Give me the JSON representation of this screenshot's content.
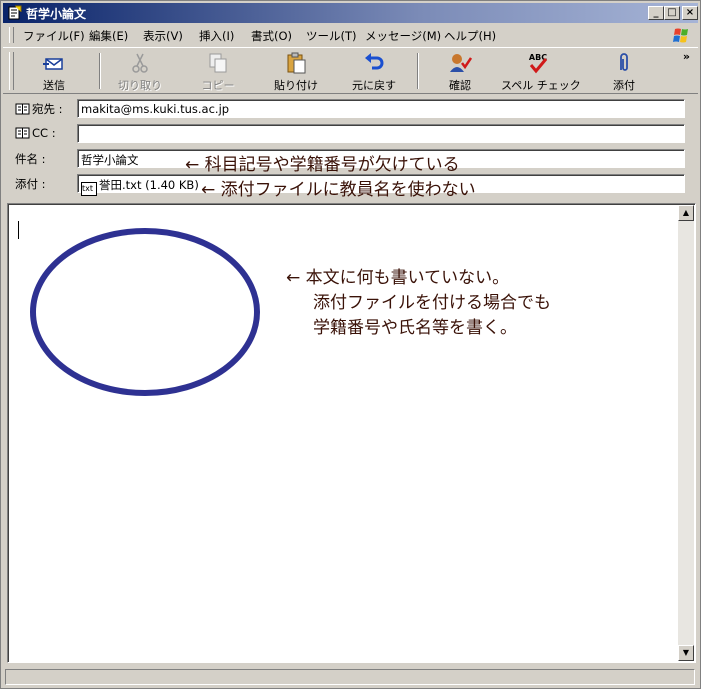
{
  "window": {
    "title": "哲学小論文",
    "min_label": "_",
    "max_label": "□",
    "close_label": "×"
  },
  "menu": {
    "items": [
      "ファイル(F)",
      "編集(E)",
      "表示(V)",
      "挿入(I)",
      "書式(O)",
      "ツール(T)",
      "メッセージ(M)",
      "ヘルプ(H)"
    ]
  },
  "toolbar": {
    "send": "送信",
    "cut": "切り取り",
    "copy": "コピー",
    "paste": "貼り付け",
    "undo": "元に戻す",
    "check": "確認",
    "spell": "スペル チェック",
    "attach": "添付",
    "overflow": "»",
    "spell_badge": "ABC"
  },
  "header": {
    "to_label": "宛先 :",
    "to_value": "makita@ms.kuki.tus.ac.jp",
    "cc_label": "CC :",
    "cc_value": "",
    "subject_label": "件名 :",
    "subject_value": "哲学小論文",
    "attach_label": "添付 :",
    "attach_icon_text": "txt",
    "attach_value": "誉田.txt (1.40 KB)"
  },
  "annotations": {
    "subject_note": "← 科目記号や学籍番号が欠けている",
    "attach_note": "← 添付ファイルに教員名を使わない",
    "body_note_1": "← 本文に何も書いていない。",
    "body_note_2": "添付ファイルを付ける場合でも",
    "body_note_3": "学籍番号や氏名等を書く。"
  },
  "colors": {
    "title_bar": "#0a246a",
    "ellipse": "#2e3192",
    "annotation": "#3a1208"
  }
}
